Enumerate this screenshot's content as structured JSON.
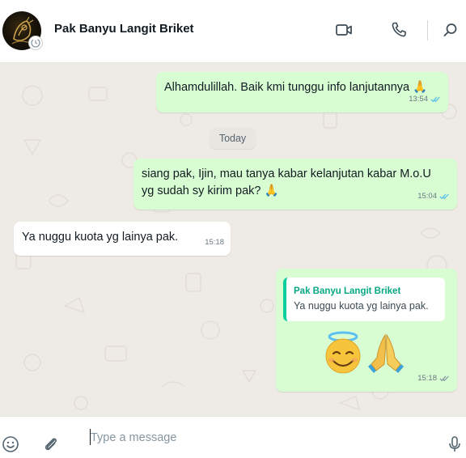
{
  "header": {
    "contact_name": "Pak Banyu Langit Briket",
    "icons": [
      "video-call-icon",
      "voice-call-icon",
      "search-icon"
    ]
  },
  "chat": {
    "date_separator": "Today",
    "messages": [
      {
        "direction": "outgoing",
        "text": "Alhamdulillah. Baik kmi tunggu info lanjutannya 🙏",
        "time": "13:54",
        "status": "read"
      },
      {
        "direction": "outgoing",
        "line1": "siang pak, Ijin, mau tanya kabar kelanjutan kabar M.o.U",
        "line2": "yg sudah sy kirim pak? 🙏",
        "time": "15:04",
        "status": "read"
      },
      {
        "direction": "incoming",
        "text": "Ya nuggu kuota yg lainya pak.",
        "time": "15:18"
      },
      {
        "direction": "outgoing",
        "quoted": {
          "author": "Pak Banyu Langit Briket",
          "text": "Ya nuggu kuota yg lainya pak."
        },
        "emojis": [
          "smiling-face-with-halo",
          "folded-hands"
        ],
        "time": "15:18",
        "status": "delivered"
      }
    ]
  },
  "footer": {
    "placeholder": "Type a message",
    "icons": [
      "emoji-icon",
      "attach-icon",
      "microphone-icon"
    ]
  },
  "colors": {
    "outgoing_bubble": "#d9fdd3",
    "incoming_bubble": "#ffffff",
    "read_tick": "#53bdeb",
    "quote_accent": "#06cf9c",
    "chat_background": "#eeeae5"
  }
}
